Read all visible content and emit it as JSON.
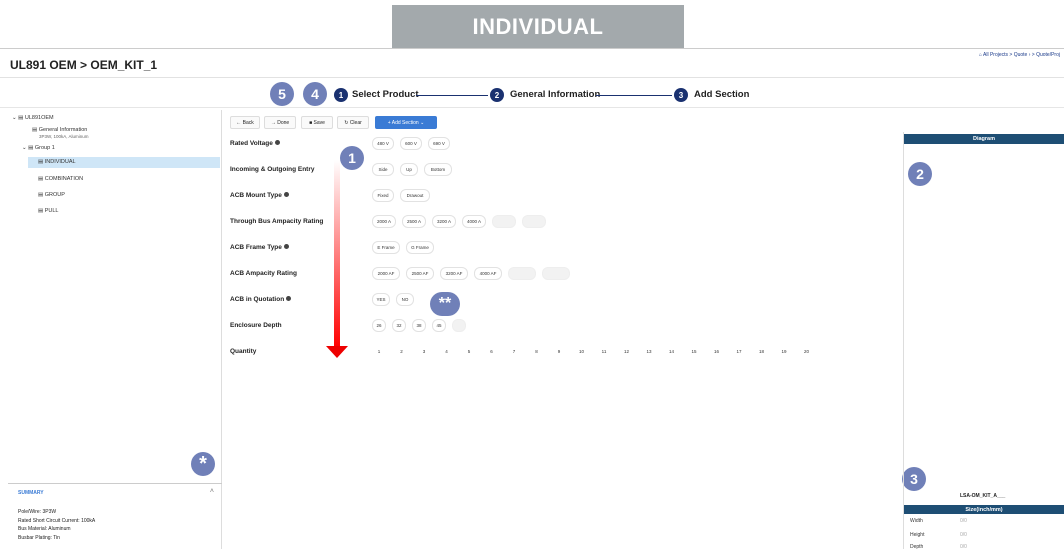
{
  "banner": "INDIVIDUAL",
  "page_title": "UL891 OEM > OEM_KIT_1",
  "breadcrumb": "⌂ All Projects > Quote › > Quote/Proj",
  "steps": [
    {
      "num": "1",
      "label": "Select Product"
    },
    {
      "num": "2",
      "label": "General Information"
    },
    {
      "num": "3",
      "label": "Add Section"
    }
  ],
  "annotations": {
    "a1": "1",
    "a2": "2",
    "a3": "3",
    "a4": "4",
    "a5": "5",
    "star": "*",
    "dstar": "**"
  },
  "tree": {
    "root": "UL891OEM",
    "general_info": "General Information",
    "general_sub": "3P3W, 100kA, Aluminum",
    "group": "Group 1",
    "items": [
      "INDIVIDUAL",
      "COMBINATION",
      "GROUP",
      "PULL"
    ]
  },
  "toolbar": {
    "back": "← Back",
    "done": "→ Done",
    "save": "■ Save",
    "clear": "↻ Clear",
    "add_section": "+ Add Section ⌄"
  },
  "fields": [
    {
      "label": "Rated Voltage",
      "info": true,
      "options": [
        "480 V",
        "600 V",
        "690 V"
      ],
      "disabled": []
    },
    {
      "label": "Incoming & Outgoing Entry",
      "info": false,
      "options": [
        "Side",
        "Up",
        "Bottom"
      ],
      "disabled": []
    },
    {
      "label": "ACB Mount Type",
      "info": true,
      "options": [
        "Fixed",
        "Drawout"
      ],
      "disabled": []
    },
    {
      "label": "Through Bus Ampacity Rating",
      "info": false,
      "options": [
        "2000 A",
        "2500 A",
        "3200 A",
        "4000 A",
        "",
        ""
      ],
      "disabled": [
        4,
        5
      ]
    },
    {
      "label": "ACB Frame Type",
      "info": true,
      "options": [
        "E Frame",
        "G Frame"
      ],
      "disabled": []
    },
    {
      "label": "ACB Ampacity Rating",
      "info": false,
      "options": [
        "2000 AF",
        "2500 AF",
        "3200 AF",
        "4000 AF",
        "",
        ""
      ],
      "disabled": [
        4,
        5
      ]
    },
    {
      "label": "ACB in Quotation",
      "info": true,
      "options": [
        "YES",
        "NO"
      ],
      "disabled": []
    },
    {
      "label": "Enclosure Depth",
      "info": false,
      "options": [
        "26",
        "32",
        "38",
        "45",
        ""
      ],
      "disabled": [
        4
      ]
    },
    {
      "label": "Quantity",
      "info": false,
      "options": [
        "1",
        "2",
        "3",
        "4",
        "5",
        "6",
        "7",
        "8",
        "9",
        "10",
        "11",
        "12",
        "13",
        "14",
        "15",
        "16",
        "17",
        "18",
        "19",
        "20"
      ],
      "disabled": []
    }
  ],
  "summary": {
    "title": "SUMMARY",
    "lines": [
      "Pole/Wire: 3P3W",
      "Rated Short Circuit Current: 100kA",
      "Bus Material: Aluminum",
      "Busbar Plating: Tin"
    ]
  },
  "diagram": {
    "title": "Diagram",
    "caption": "LSA-OM_KIT_A___"
  },
  "size": {
    "title": "Size(inch/mm)",
    "rows": [
      {
        "label": "Width",
        "value": "0/0"
      },
      {
        "label": "Height",
        "value": "0/0"
      },
      {
        "label": "Depth",
        "value": "0/0"
      }
    ]
  },
  "colors": {
    "accent": "#1a3170",
    "annotation": "#7080b8",
    "primary_button": "#3a7bd5",
    "panel_header": "#1e4e74",
    "arrow": "#e00000"
  }
}
